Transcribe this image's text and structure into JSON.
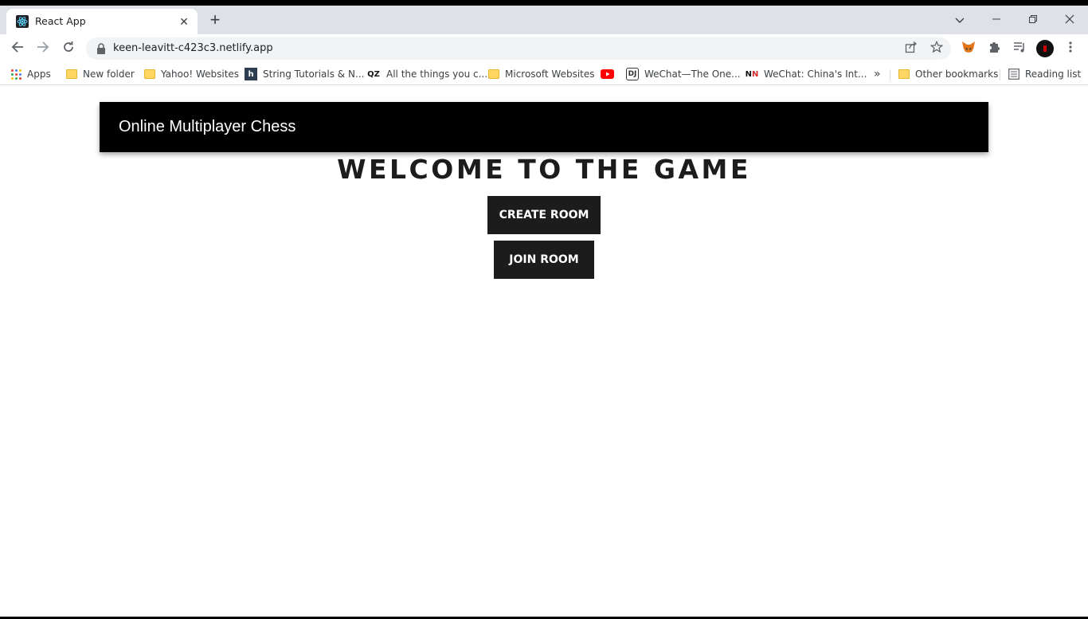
{
  "browser": {
    "tab": {
      "title": "React App",
      "favicon": "react-icon"
    },
    "toolbar": {
      "url": "keen-leavitt-c423c3.netlify.app"
    },
    "bookmarks": [
      {
        "label": "Apps",
        "icon": "apps-grid-icon"
      },
      {
        "label": "New folder",
        "icon": "folder-icon"
      },
      {
        "label": "Yahoo! Websites",
        "icon": "folder-icon"
      },
      {
        "label": "String Tutorials & N...",
        "icon": "h-icon"
      },
      {
        "label": "All the things you c...",
        "icon": "qz-icon"
      },
      {
        "label": "Microsoft Websites",
        "icon": "folder-icon"
      },
      {
        "label": "",
        "icon": "youtube-icon"
      },
      {
        "label": "WeChat—The One...",
        "icon": "dj-icon"
      },
      {
        "label": "WeChat: China's Int...",
        "icon": "nn-icon"
      },
      {
        "label": "»",
        "icon": "overflow-chevron-icon"
      },
      {
        "label": "Other bookmarks",
        "icon": "folder-icon"
      },
      {
        "label": "Reading list",
        "icon": "reading-list-icon"
      }
    ]
  },
  "page": {
    "navbar_title": "Online Multiplayer Chess",
    "heading": "WELCOME TO THE GAME",
    "create_room_label": "CREATE ROOM",
    "join_room_label": "JOIN ROOM"
  },
  "colors": {
    "navbar_bg": "#000000",
    "button_bg": "#1c1c1c",
    "tabstrip_bg": "#dee1e6"
  }
}
